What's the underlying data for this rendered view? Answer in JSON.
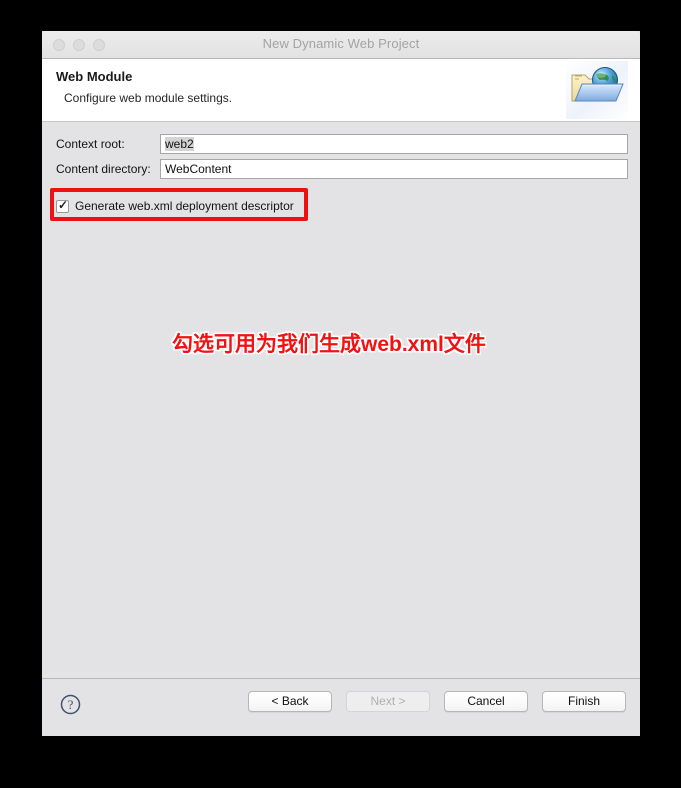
{
  "window": {
    "title": "New Dynamic Web Project",
    "traffic_lights": [
      "close-button",
      "minimize-button",
      "zoom-button"
    ]
  },
  "header": {
    "title": "Web Module",
    "subtitle": "Configure web module settings.",
    "icon": "web-project-folder-globe-icon"
  },
  "form": {
    "fields": [
      {
        "label": "Context root:",
        "value": "web2",
        "selected": true
      },
      {
        "label": "Content directory:",
        "value": "WebContent",
        "selected": false
      }
    ],
    "checkbox": {
      "label": "Generate web.xml deployment descriptor",
      "checked": true,
      "check_glyph": "✓"
    }
  },
  "annotation": {
    "text": "勾选可用为我们生成web.xml文件",
    "color": "#f41111",
    "highlight_box_color": "#ee1111"
  },
  "footer": {
    "help_icon": "help-question-icon",
    "buttons": [
      {
        "label": "< Back",
        "name": "back-button",
        "disabled": false
      },
      {
        "label": "Next >",
        "name": "next-button",
        "disabled": true
      },
      {
        "label": "Cancel",
        "name": "cancel-button",
        "disabled": false
      },
      {
        "label": "Finish",
        "name": "finish-button",
        "disabled": false
      }
    ]
  }
}
